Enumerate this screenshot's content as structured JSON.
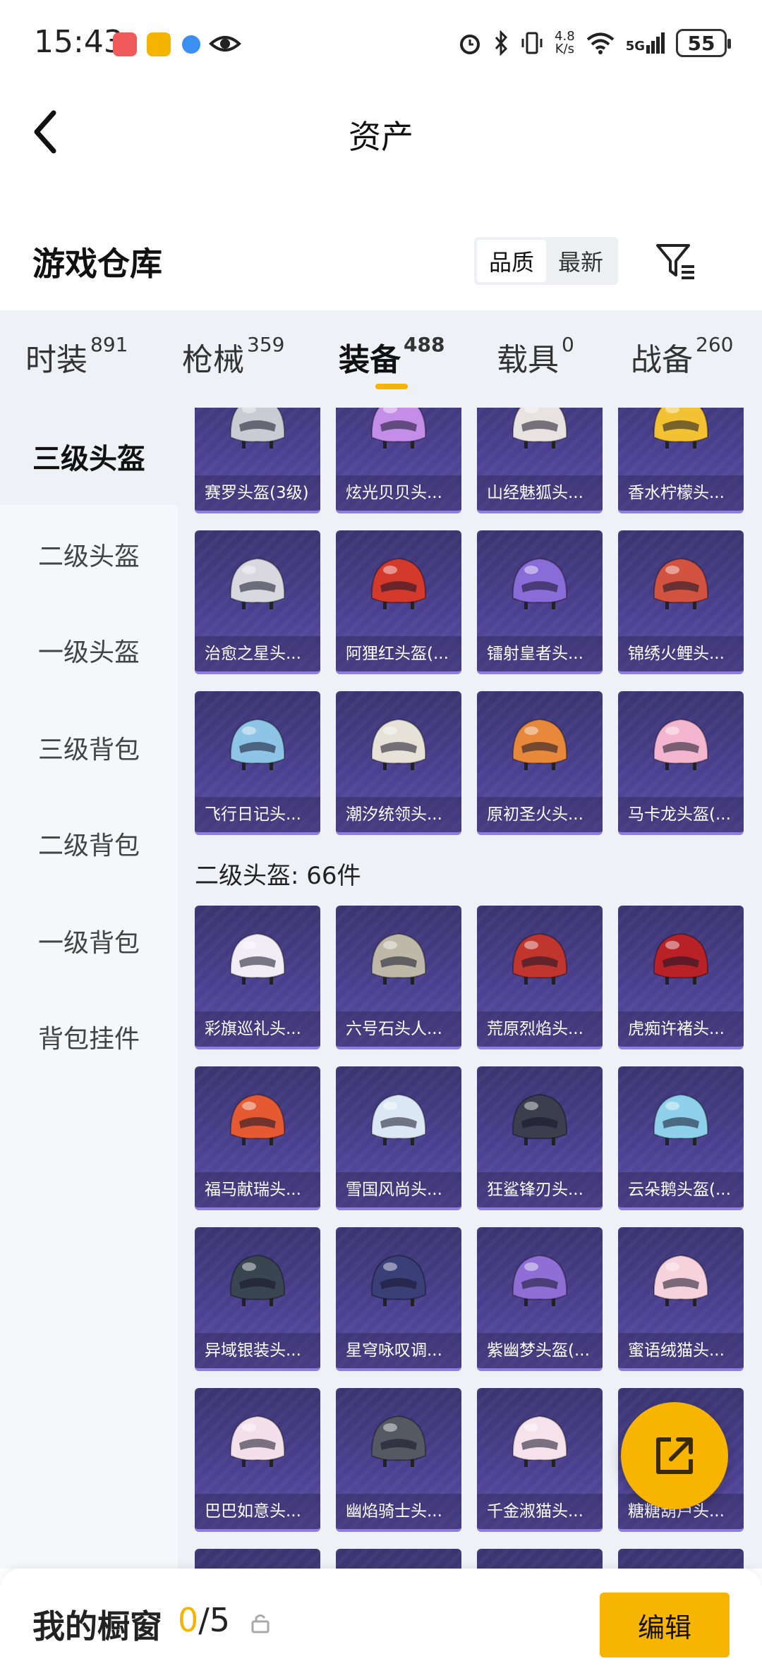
{
  "status_bar": {
    "time": "15:43",
    "net_speed_value": "4.8",
    "net_speed_unit": "K/s",
    "signal": "5G",
    "battery": "55"
  },
  "header": {
    "title": "资产"
  },
  "warehouse": {
    "title": "游戏仓库",
    "sort_options": [
      "品质",
      "最新"
    ]
  },
  "tabs": [
    {
      "label": "时装",
      "count": "891"
    },
    {
      "label": "枪械",
      "count": "359"
    },
    {
      "label": "装备",
      "count": "488"
    },
    {
      "label": "载具",
      "count": "0"
    },
    {
      "label": "战备",
      "count": "260"
    }
  ],
  "sidebar": {
    "items": [
      "三级头盔",
      "二级头盔",
      "一级头盔",
      "三级背包",
      "二级背包",
      "一级背包",
      "背包挂件"
    ]
  },
  "sections": {
    "level3_items": [
      "赛罗头盔(3级)",
      "炫光贝贝头...",
      "山经魅狐头...",
      "香水柠檬头...",
      "治愈之星头...",
      "阿狸红头盔(...",
      "镭射皇者头...",
      "锦绣火鲤头...",
      "飞行日记头...",
      "潮汐统领头...",
      "原初圣火头...",
      "马卡龙头盔(..."
    ],
    "level2_title": "二级头盔: 66件",
    "level2_items": [
      "彩旗巡礼头...",
      "六号石头人...",
      "荒原烈焰头...",
      "虎痴许褚头...",
      "福马献瑞头...",
      "雪国风尚头...",
      "狂鲨锋刃头...",
      "云朵鹅头盔(...",
      "异域银装头...",
      "星穹咏叹调...",
      "紫幽梦头盔(...",
      "蜜语绒猫头...",
      "巴巴如意头...",
      "幽焰骑士头...",
      "千金淑猫头...",
      "糖糖葫芦头..."
    ]
  },
  "helmet_colors": {
    "level3": [
      "#c9ccd3",
      "#c48ee8",
      "#e8e2e0",
      "#f2c232",
      "#d8d8de",
      "#d43a2c",
      "#8a6cd8",
      "#d2533f",
      "#8ec4e6",
      "#e6e2d8",
      "#e8883a",
      "#f4b6cf"
    ],
    "level2": [
      "#f2ecf4",
      "#bdb8a8",
      "#c0352e",
      "#b82226",
      "#e55a32",
      "#dbe8f4",
      "#3b3f4d",
      "#8fd0ea",
      "#3a4552",
      "#3a3f78",
      "#8f6fd6",
      "#f5d2dc",
      "#f3e0ea",
      "#555a62",
      "#f6e2ea",
      "#e0788a"
    ]
  },
  "bottom_bar": {
    "label": "我的橱窗",
    "used": "0",
    "total": "/5",
    "edit_label": "编辑"
  }
}
